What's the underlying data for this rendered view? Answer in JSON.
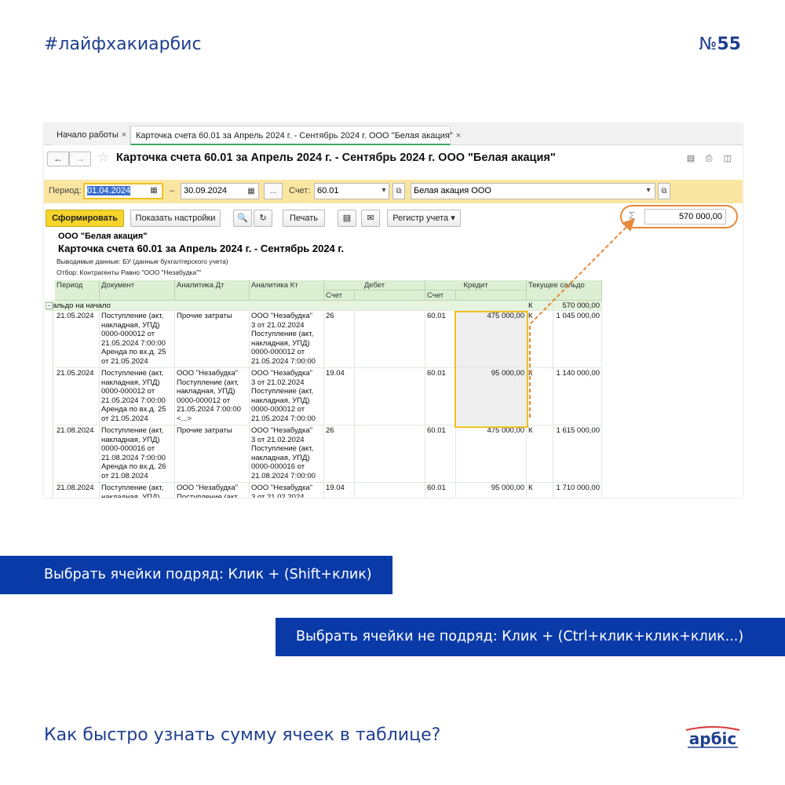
{
  "header": {
    "hashtag": "#лайфхакиарбис",
    "issue_prefix": "№",
    "issue_number": "55"
  },
  "tabs": [
    {
      "label": "Начало работы"
    },
    {
      "label": "Карточка счета 60.01 за Апрель 2024 г. - Сентябрь 2024 г. ООО \"Белая акация\""
    }
  ],
  "window": {
    "title": "Карточка счета 60.01 за Апрель 2024 г. - Сентябрь 2024 г. ООО \"Белая акация\""
  },
  "filters": {
    "period_label": "Период:",
    "date_from": "01.04.2024",
    "dash": "–",
    "date_to": "30.09.2024",
    "more": "...",
    "account_label": "Счет:",
    "account": "60.01",
    "org": "Белая акация ООО"
  },
  "toolbar": {
    "generate": "Сформировать",
    "show_settings": "Показать настройки",
    "print": "Печать",
    "register": "Регистр учета",
    "sum_symbol": "Σ",
    "sum_value": "570 000,00"
  },
  "report": {
    "org": "ООО \"Белая акация\"",
    "title": "Карточка счета 60.01 за Апрель 2024 г. - Сентябрь 2024 г.",
    "output": "Выводимые данные: БУ (данные бухгалтерского учета)",
    "filter": "Отбор: Контрагенты Равно \"ООО \"Незабудка\"\"",
    "columns": {
      "period": "Период",
      "document": "Документ",
      "analytics_dt": "Аналитика Дт",
      "analytics_kt": "Аналитика Кт",
      "debit": "Дебет",
      "credit": "Кредит",
      "balance": "Текущее сальдо",
      "account": "Счет"
    },
    "opening": {
      "label": "Сальдо на начало",
      "side": "К",
      "value": "570 000,00"
    },
    "rows": [
      {
        "period": "21.05.2024",
        "document": "Поступление (акт,\nнакладная, УПД)\n0000-000012 от\n21.05.2024 7:00:00\nАренда по вх.д. 25\nот 21.05.2024",
        "dt": "Прочие затраты",
        "kt": "ООО \"Незабудка\"\n3 от 21.02.2024\nПоступление (акт,\nнакладная, УПД)\n0000-000012 от\n21.05.2024 7:00:00",
        "debit_account": "26",
        "credit_account": "60.01",
        "credit": "475 000,00",
        "side": "К",
        "balance": "1 045 000,00"
      },
      {
        "period": "21.05.2024",
        "document": "Поступление (акт,\nнакладная, УПД)\n0000-000012 от\n21.05.2024 7:00:00\nАренда по вх.д. 25\nот 21.05.2024",
        "dt": "ООО \"Незабудка\"\nПоступление (акт,\nнакладная, УПД)\n0000-000012 от\n21.05.2024 7:00:00\n<...>",
        "kt": "ООО \"Незабудка\"\n3 от 21.02.2024\nПоступление (акт,\nнакладная, УПД)\n0000-000012 от\n21.05.2024 7:00:00",
        "debit_account": "19.04",
        "credit_account": "60.01",
        "credit": "95 000,00",
        "side": "К",
        "balance": "1 140 000,00"
      },
      {
        "period": "21.08.2024",
        "document": "Поступление (акт,\nнакладная, УПД)\n0000-000016 от\n21.08.2024 7:00:00\nАренда по вх.д. 26\nот 21.08.2024",
        "dt": "Прочие затраты",
        "kt": "ООО \"Незабудка\"\n3 от 21.02.2024\nПоступление (акт,\nнакладная, УПД)\n0000-000016 от\n21.08.2024 7:00:00",
        "debit_account": "26",
        "credit_account": "60.01",
        "credit": "475 000,00",
        "side": "К",
        "balance": "1 615 000,00"
      },
      {
        "period": "21.08.2024",
        "document": "Поступление (акт,\nнакладная, УПД)",
        "dt": "ООО \"Незабудка\"\nПоступление (акт",
        "kt": "ООО \"Незабудка\"\n3 от 21.02.2024",
        "debit_account": "19.04",
        "credit_account": "60.01",
        "credit": "95 000,00",
        "side": "К",
        "balance": "1 710 000,00"
      }
    ]
  },
  "tips": {
    "consecutive": "Выбрать ячейки подряд: Клик + (Shift+клик)",
    "nonconsecutive": "Выбрать ячейки не подряд:  Клик + (Ctrl+клик+клик+клик...)"
  },
  "question": "Как быстро узнать сумму ячеек в таблице?",
  "colors": {
    "brand": "#0a3aa8",
    "accent_orange": "#e8883a",
    "selection_yellow": "#f2c01f",
    "header_green": "#dcefd3"
  }
}
